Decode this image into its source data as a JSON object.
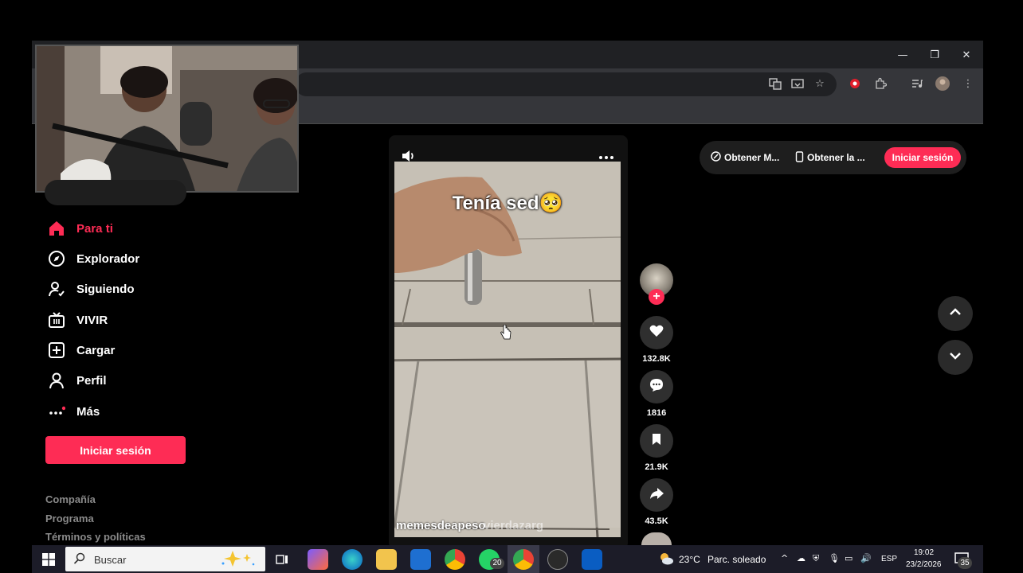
{
  "sidebar": {
    "search_placeholder": "Buscar",
    "items": [
      {
        "label": "Para ti",
        "icon": "home-icon"
      },
      {
        "label": "Explorador",
        "icon": "compass-icon"
      },
      {
        "label": "Siguiendo",
        "icon": "following-icon"
      },
      {
        "label": "VIVIR",
        "icon": "live-icon"
      },
      {
        "label": "Cargar",
        "icon": "upload-icon"
      },
      {
        "label": "Perfil",
        "icon": "profile-icon"
      },
      {
        "label": "Más",
        "icon": "more-icon"
      }
    ],
    "login_label": "Iniciar sesión",
    "footer": [
      "Compañía",
      "Programa",
      "Términos y políticas"
    ]
  },
  "video": {
    "caption": "Tenía sed",
    "caption_emoji": "🥺",
    "username_watermark": "memesdeapeso",
    "secondary_watermark": "vierdazarg"
  },
  "actions": {
    "likes": "132.8K",
    "comments": "1816",
    "saves": "21.9K",
    "shares": "43.5K"
  },
  "topbar": {
    "get_app_1": "Obtener M...",
    "get_app_2": "Obtener la ...",
    "login_label": "Iniciar sesión"
  },
  "taskbar": {
    "search_label": "Buscar",
    "whatsapp_badge": "20",
    "weather": "23°C",
    "weather_desc": "Parc. soleado",
    "lang": "ESP",
    "time": "19:02",
    "date": "23/2/2026",
    "notifications": "35"
  },
  "colors": {
    "accent": "#fe2c55",
    "background": "#000000",
    "action_button": "#2f2f2f"
  }
}
